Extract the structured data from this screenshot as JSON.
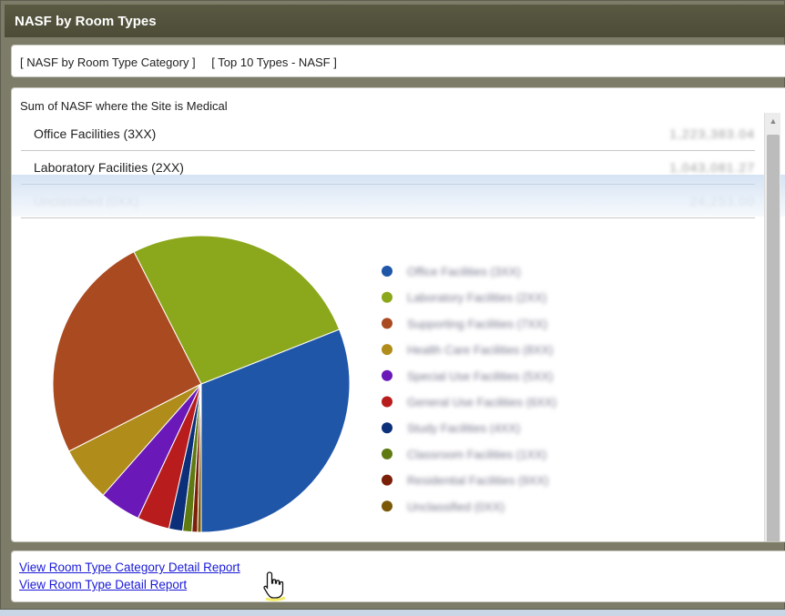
{
  "panel": {
    "title": "NASF by Room Types",
    "tabs": [
      "[ NASF by Room Type Category ]",
      "[ Top 10 Types - NASF ]"
    ]
  },
  "content": {
    "title": "Sum of NASF where the Site is Medical",
    "rows": [
      {
        "label": "Office Facilities (3XX)",
        "value": "1,223,383.04"
      },
      {
        "label": "Laboratory Facilities (2XX)",
        "value": "1,043,081.27"
      },
      {
        "label": "Unclassified (0XX)",
        "value": "24,253.00"
      }
    ]
  },
  "chart_data": {
    "type": "pie",
    "categories": [
      "Office Facilities (3XX)",
      "Laboratory Facilities (2XX)",
      "Supporting Facilities (7XX)",
      "Health Care Facilities (8XX)",
      "Special Use Facilities (5XX)",
      "General Use Facilities (6XX)",
      "Study Facilities (4XX)",
      "Classroom Facilities (1XX)",
      "Residential Facilities (9XX)",
      "Unclassified (0XX)"
    ],
    "values": [
      31.0,
      26.5,
      25.0,
      6.0,
      4.5,
      3.5,
      1.5,
      1.0,
      0.6,
      0.4
    ],
    "colors": [
      "#1f56a8",
      "#8ba81c",
      "#aa4a20",
      "#b08c1a",
      "#6a18b8",
      "#b81c1c",
      "#0c2f7a",
      "#5e7a10",
      "#7a2008",
      "#7a5808"
    ],
    "legend_position": "right",
    "title": ""
  },
  "links": {
    "category_report": "View Room Type Category Detail Report",
    "type_report": "View Room Type Detail Report"
  }
}
